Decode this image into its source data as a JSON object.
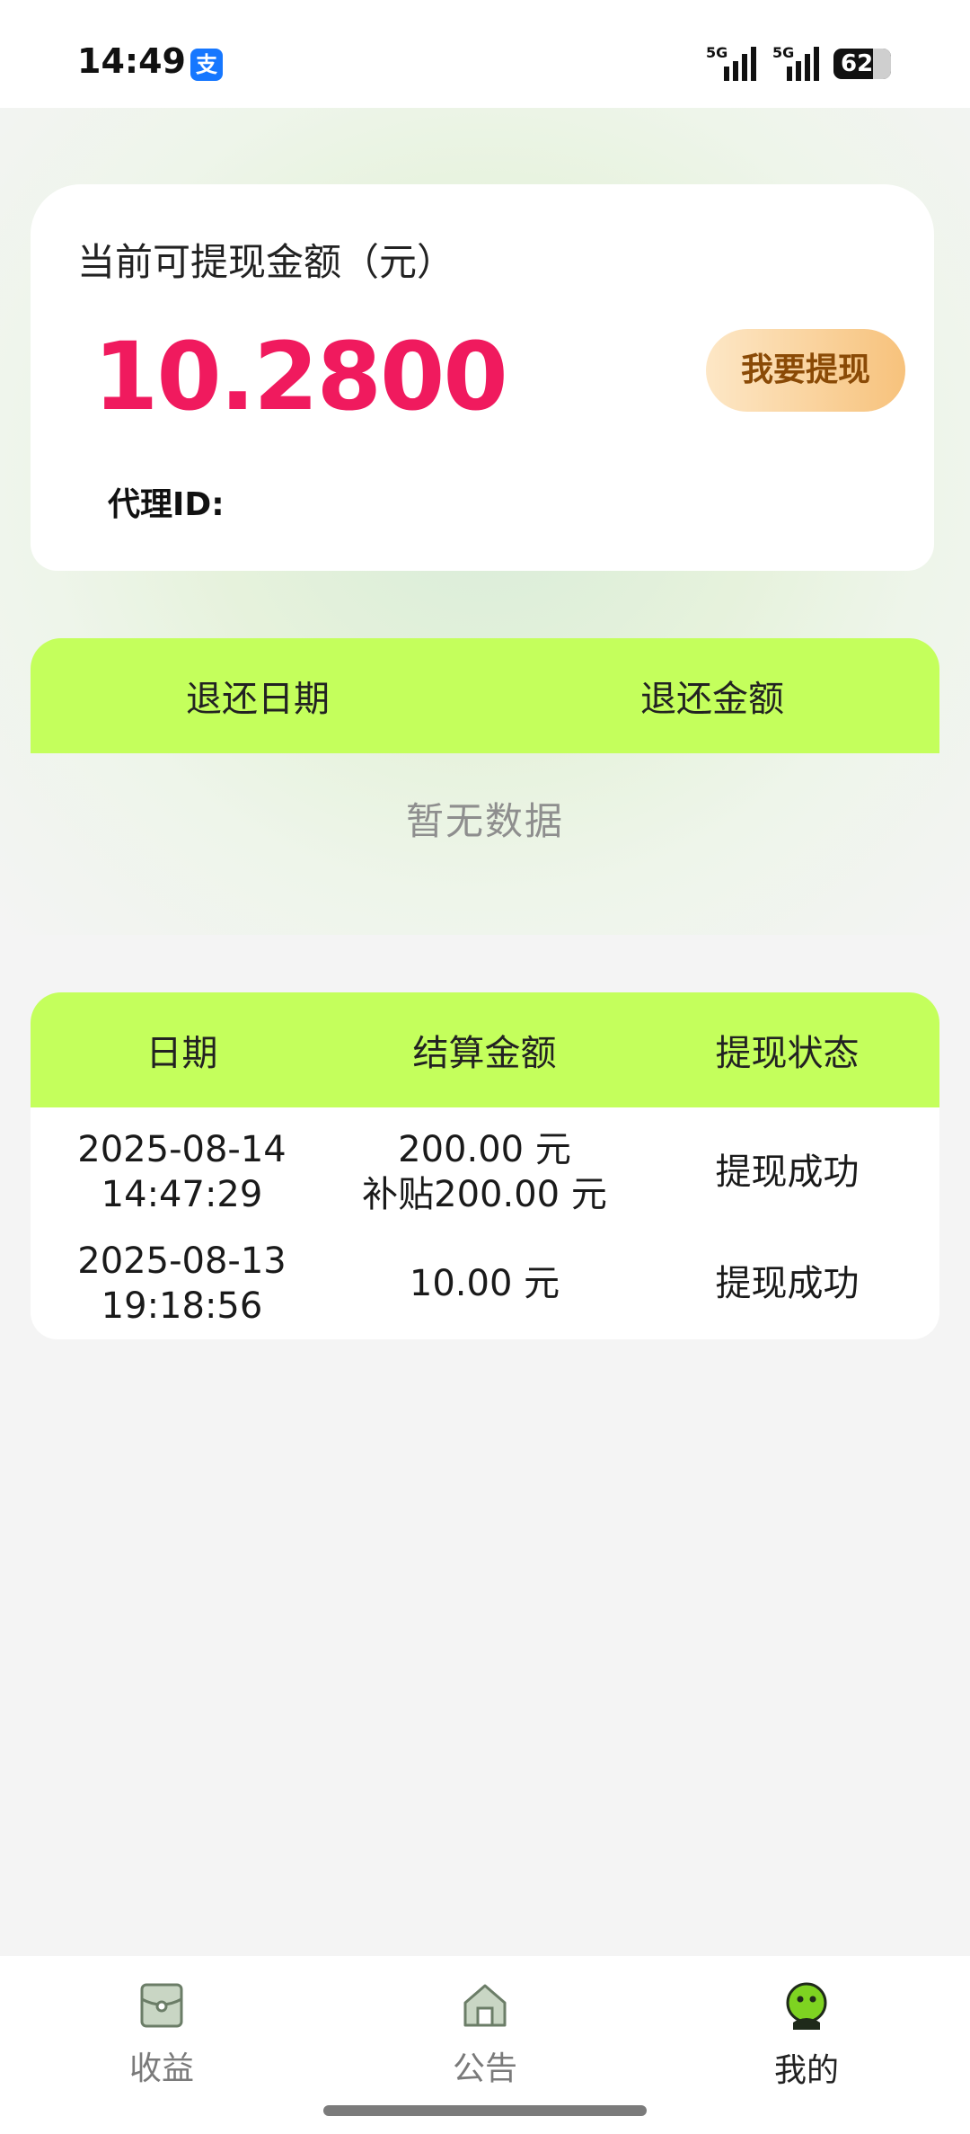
{
  "status_bar": {
    "time": "14:49",
    "alipay_icon": "支",
    "signal_1": "5G",
    "signal_2": "5G",
    "battery": "62"
  },
  "balance_card": {
    "label": "当前可提现金额（元）",
    "amount": "10.2800",
    "withdraw_button": "我要提现",
    "agent_id_label": "代理ID:"
  },
  "refund_table": {
    "headers": [
      "退还日期",
      "退还金额"
    ],
    "empty_text": "暂无数据"
  },
  "settlement_table": {
    "headers": [
      "日期",
      "结算金额",
      "提现状态"
    ],
    "rows": [
      {
        "date": "2025-08-14",
        "time": "14:47:29",
        "amount": "200.00 元",
        "subsidy": "补贴200.00 元",
        "status": "提现成功"
      },
      {
        "date": "2025-08-13",
        "time": "19:18:56",
        "amount": "10.00 元",
        "status": "提现成功"
      }
    ]
  },
  "tab_bar": {
    "items": [
      {
        "label": "收益",
        "icon": "wallet-icon"
      },
      {
        "label": "公告",
        "icon": "home-icon"
      },
      {
        "label": "我的",
        "icon": "user-icon",
        "active": true
      }
    ]
  },
  "colors": {
    "accent_green": "#c4ff5c",
    "amount_pink": "#f01a5e",
    "button_gold": "#f7c27c"
  }
}
